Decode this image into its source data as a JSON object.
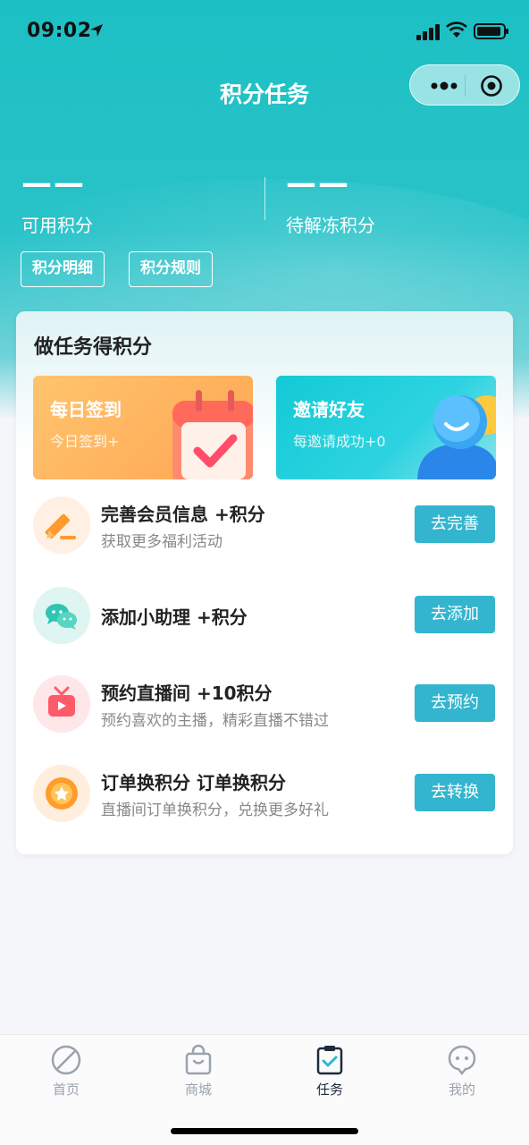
{
  "status_bar": {
    "time": "09:02"
  },
  "nav": {
    "title": "积分任务"
  },
  "points": {
    "available_value": "——",
    "available_label": "可用积分",
    "frozen_value": "——",
    "frozen_label": "待解冻积分"
  },
  "hero_buttons": {
    "detail": "积分明细",
    "rules": "积分规则"
  },
  "card": {
    "title": "做任务得积分",
    "promos": [
      {
        "title": "每日签到",
        "subtitle": "今日签到+"
      },
      {
        "title": "邀请好友",
        "subtitle": "每邀请成功+0"
      }
    ],
    "tasks": [
      {
        "title": "完善会员信息 +积分",
        "desc": "获取更多福利活动",
        "button": "去完善",
        "icon": "pencil-icon"
      },
      {
        "title": "添加小助理 +积分",
        "desc": "",
        "button": "去添加",
        "icon": "wechat-icon"
      },
      {
        "title": "预约直播间 +10积分",
        "desc": "预约喜欢的主播，精彩直播不错过",
        "button": "去预约",
        "icon": "tv-icon"
      },
      {
        "title": "订单换积分 订单换积分",
        "desc": "直播间订单换积分，兑换更多好礼",
        "button": "去转换",
        "icon": "star-coin-icon"
      }
    ]
  },
  "tabbar": {
    "items": [
      {
        "label": "首页",
        "icon": "compass-icon",
        "active": false
      },
      {
        "label": "商城",
        "icon": "shopping-bag-icon",
        "active": false
      },
      {
        "label": "任务",
        "icon": "clipboard-check-icon",
        "active": true
      },
      {
        "label": "我的",
        "icon": "profile-icon",
        "active": false
      }
    ]
  },
  "colors": {
    "primary": "#1cc0c4",
    "button": "#33b5cf",
    "checkin_card": "#ffa552",
    "invite_card": "#13cad6"
  }
}
